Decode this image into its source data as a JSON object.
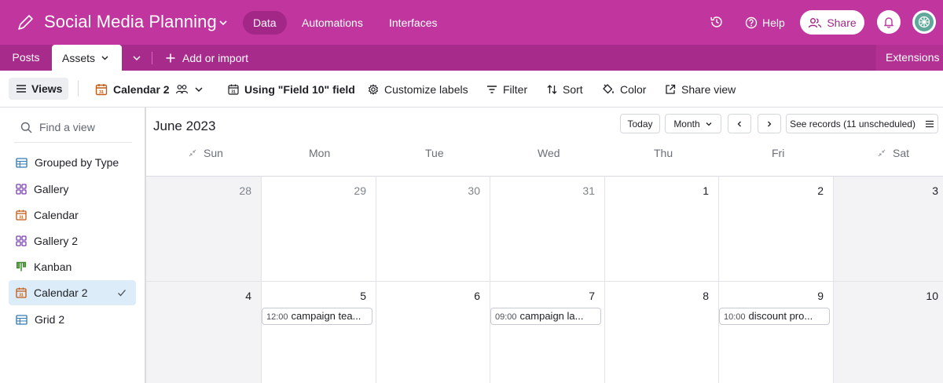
{
  "header": {
    "title": "Social Media Planning",
    "nav": [
      "Data",
      "Automations",
      "Interfaces"
    ],
    "help_label": "Help",
    "share_label": "Share",
    "brand_color": "#c0369e"
  },
  "tables": {
    "items": [
      "Posts",
      "Assets"
    ],
    "add_import_label": "Add or import",
    "extensions_label": "Extensions"
  },
  "toolbar": {
    "views_label": "Views",
    "current_view": "Calendar 2",
    "date_field": "Using \"Field 10\" field",
    "customize": "Customize labels",
    "filter": "Filter",
    "sort": "Sort",
    "color": "Color",
    "share_view": "Share view"
  },
  "sidebar": {
    "search_placeholder": "Find a view",
    "views": [
      {
        "label": "Grouped by Type",
        "icon": "grid-icon"
      },
      {
        "label": "Gallery",
        "icon": "gallery-icon"
      },
      {
        "label": "Calendar",
        "icon": "calendar-icon"
      },
      {
        "label": "Gallery 2",
        "icon": "gallery-icon"
      },
      {
        "label": "Kanban",
        "icon": "kanban-icon"
      },
      {
        "label": "Calendar 2",
        "icon": "calendar-icon",
        "selected": true
      },
      {
        "label": "Grid 2",
        "icon": "grid-icon"
      }
    ]
  },
  "calendar": {
    "month": "June 2023",
    "today_label": "Today",
    "range_label": "Month",
    "records_label": "See records (11 unscheduled)",
    "weekdays": [
      "Sun",
      "Mon",
      "Tue",
      "Wed",
      "Thu",
      "Fri",
      "Sat"
    ],
    "weeks": [
      [
        "28",
        "29",
        "30",
        "31",
        "1",
        "2",
        "3"
      ],
      [
        "4",
        "5",
        "6",
        "7",
        "8",
        "9",
        "10"
      ]
    ],
    "events": [
      {
        "time": "12:00",
        "title": "campaign tea..."
      },
      {
        "time": "09:00",
        "title": "campaign la..."
      },
      {
        "time": "10:00",
        "title": "discount pro..."
      }
    ]
  }
}
